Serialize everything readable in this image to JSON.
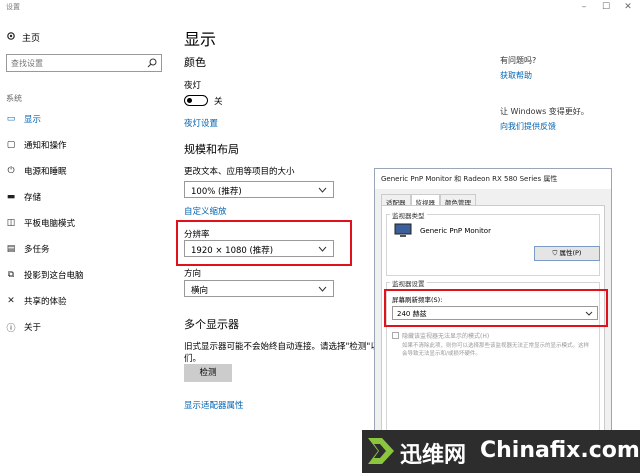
{
  "window": {
    "title": "设置",
    "controls": [
      "–",
      "☐",
      "✕"
    ]
  },
  "sidebar": {
    "home_label": "主页",
    "search_placeholder": "查找设置",
    "section_label": "系统",
    "items": [
      {
        "label": "显示",
        "icon": "monitor-icon"
      },
      {
        "label": "通知和操作",
        "icon": "notification-icon"
      },
      {
        "label": "电源和睡眠",
        "icon": "power-icon"
      },
      {
        "label": "存储",
        "icon": "storage-icon"
      },
      {
        "label": "平板电脑模式",
        "icon": "tablet-icon"
      },
      {
        "label": "多任务",
        "icon": "multitask-icon"
      },
      {
        "label": "投影到这台电脑",
        "icon": "project-icon"
      },
      {
        "label": "共享的体验",
        "icon": "share-icon"
      },
      {
        "label": "关于",
        "icon": "info-icon"
      }
    ]
  },
  "main": {
    "title": "显示",
    "color_heading": "颜色",
    "night_light_label": "夜灯",
    "night_light_state": "关",
    "night_light_settings_link": "夜灯设置",
    "scale_heading": "规模和布局",
    "scale_label": "更改文本、应用等项目的大小",
    "scale_value": "100% (推荐)",
    "custom_scale_link": "自定义缩放",
    "resolution_label": "分辨率",
    "resolution_value": "1920 × 1080 (推荐)",
    "orientation_label": "方向",
    "orientation_value": "横向",
    "multi_display_heading": "多个显示器",
    "multi_display_desc_line1": "旧式显示器可能不会始终自动连接。请选择\"检测\"以便",
    "multi_display_desc_line2": "们。",
    "detect_button": "检测",
    "adapter_link": "显示适配器属性"
  },
  "right_panel": {
    "question": "有问题吗?",
    "help_link": "获取帮助",
    "improve_text": "让 Windows 变得更好。",
    "feedback_link": "向我们提供反馈"
  },
  "dialog": {
    "title": "Generic PnP Monitor 和 Radeon RX 580 Series 属性",
    "tabs": [
      "适配器",
      "监视器",
      "颜色管理"
    ],
    "monitor_type_group": "监视器类型",
    "monitor_name": "Generic PnP Monitor",
    "properties_button": "属性(P)",
    "monitor_settings_group": "监视器设置",
    "refresh_label": "屏幕刷新频率(S):",
    "refresh_value": "240 赫兹",
    "hide_modes_label": "隐藏该监视器无法显示的模式(H)",
    "hide_modes_desc": "如果不清除此项，则你可以选择那些该监视器无法正常显示的显示模式。这样会导致无法显示和/或损坏硬件。"
  },
  "watermark": {
    "cn": "迅维网",
    "en": "Chinafix.com"
  },
  "colors": {
    "accent": "#0063b1",
    "highlight": "#e0111a"
  }
}
